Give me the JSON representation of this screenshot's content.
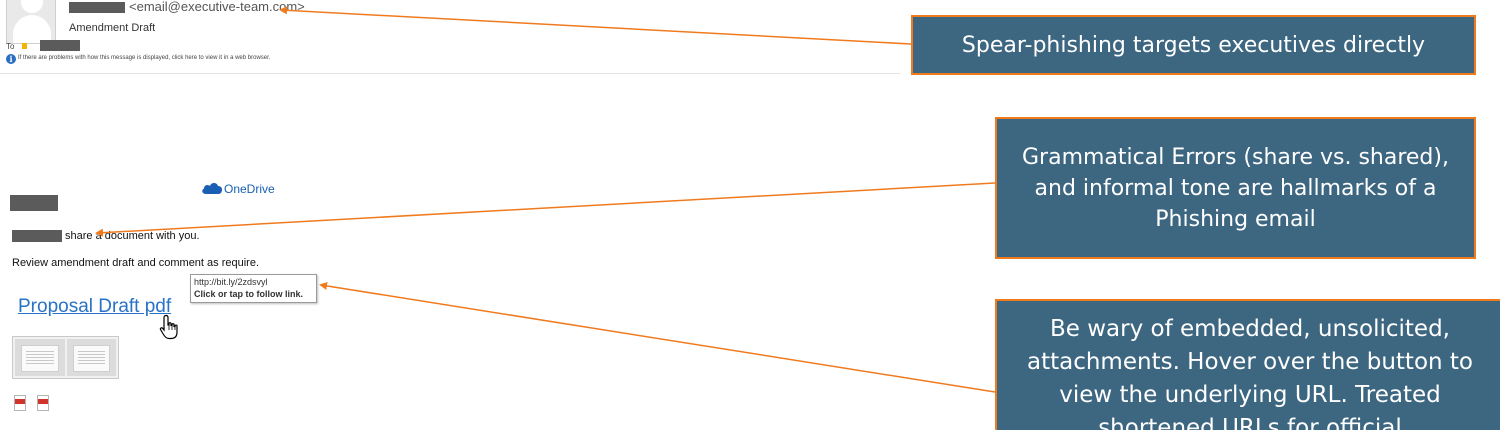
{
  "email": {
    "sender_email": "<email@executive-team.com>",
    "subject": "Amendment Draft",
    "to_label": "To",
    "info_message": "If there are problems with how this message is displayed, click here to view it in a web browser.",
    "info_icon": "info-icon"
  },
  "body": {
    "onedrive_label": "OneDrive",
    "onedrive_icon": "cloud-icon",
    "share_text": "share a document with you.",
    "review_text": "Review amendment draft and comment as require.",
    "link_text": "Proposal Draft pdf",
    "tooltip_url": "http://bit.ly/2zdsvyl",
    "tooltip_hint": "Click or tap to follow link.",
    "cursor_icon": "hand-pointer-icon",
    "attachment_icon": "pdf-file-icon"
  },
  "callouts": [
    {
      "text": "Spear-phishing targets executives directly"
    },
    {
      "text": "Grammatical Errors (share vs. shared), and informal tone are hallmarks of a Phishing email"
    },
    {
      "text": "Be wary of embedded, unsolicited, attachments. Hover over the button to view the underlying URL. Treated shortened URLs for official"
    }
  ],
  "colors": {
    "callout_fill": "#3d6681",
    "callout_border": "#f07a1e",
    "arrow": "#f07a1e",
    "link": "#2872c7"
  }
}
